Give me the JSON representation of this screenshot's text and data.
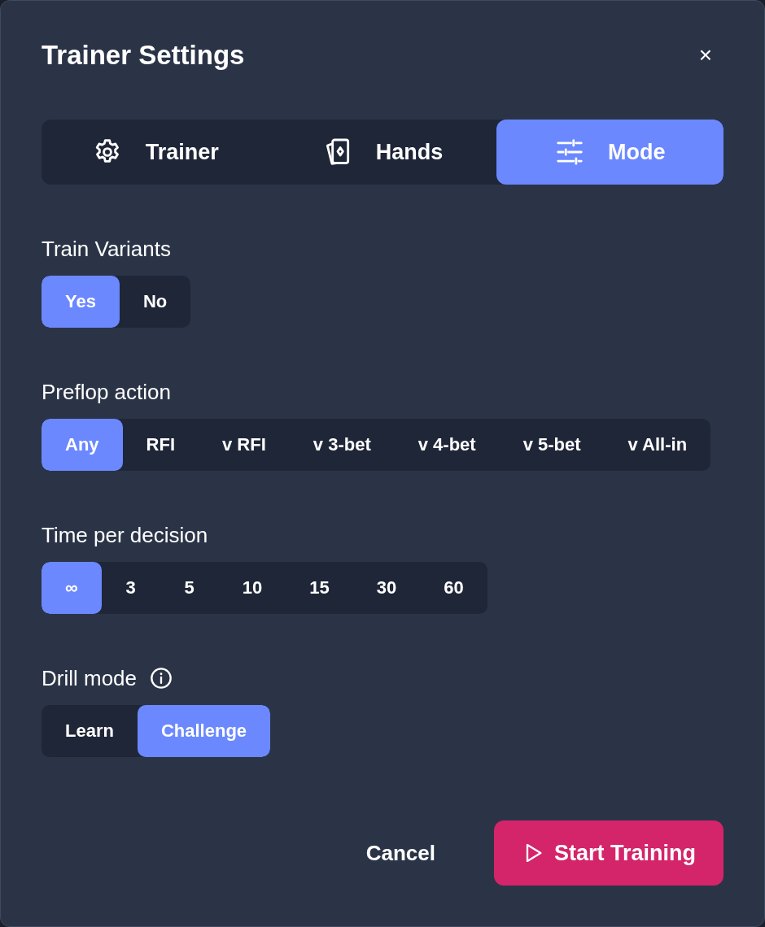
{
  "dialog": {
    "title": "Trainer Settings",
    "close": "×"
  },
  "tabs": [
    {
      "label": "Trainer",
      "selected": false
    },
    {
      "label": "Hands",
      "selected": false
    },
    {
      "label": "Mode",
      "selected": true
    }
  ],
  "sections": [
    {
      "label": "Train Variants",
      "info": false,
      "options": [
        {
          "label": "Yes",
          "selected": true
        },
        {
          "label": "No",
          "selected": false
        }
      ]
    },
    {
      "label": "Preflop action",
      "info": false,
      "options": [
        {
          "label": "Any",
          "selected": true
        },
        {
          "label": "RFI",
          "selected": false
        },
        {
          "label": "v RFI",
          "selected": false
        },
        {
          "label": "v 3-bet",
          "selected": false
        },
        {
          "label": "v 4-bet",
          "selected": false
        },
        {
          "label": "v 5-bet",
          "selected": false
        },
        {
          "label": "v All-in",
          "selected": false
        }
      ]
    },
    {
      "label": "Time per decision",
      "info": false,
      "options": [
        {
          "label": "∞",
          "selected": true
        },
        {
          "label": "3",
          "selected": false
        },
        {
          "label": "5",
          "selected": false
        },
        {
          "label": "10",
          "selected": false
        },
        {
          "label": "15",
          "selected": false
        },
        {
          "label": "30",
          "selected": false
        },
        {
          "label": "60",
          "selected": false
        }
      ]
    },
    {
      "label": "Drill mode",
      "info": true,
      "options": [
        {
          "label": "Learn",
          "selected": false
        },
        {
          "label": "Challenge",
          "selected": true
        }
      ]
    }
  ],
  "buttons": {
    "cancel": "Cancel",
    "start": "Start Training"
  }
}
